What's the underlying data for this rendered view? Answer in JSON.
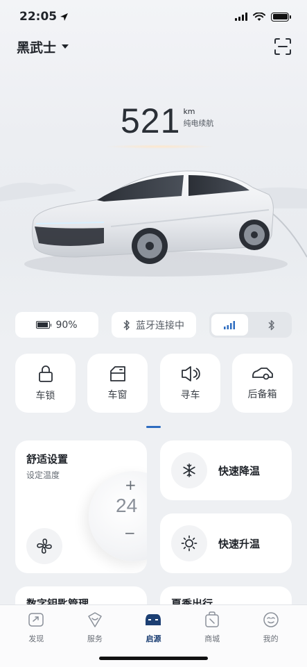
{
  "status": {
    "time": "22:05"
  },
  "header": {
    "vehicle_name": "黑武士"
  },
  "range": {
    "value": "521",
    "unit": "km",
    "label": "纯电续航"
  },
  "status_pills": {
    "battery_percent": "90%",
    "bluetooth_status": "蓝牙连接中"
  },
  "controls": [
    {
      "label": "车锁",
      "icon": "lock-icon"
    },
    {
      "label": "车窗",
      "icon": "window-icon"
    },
    {
      "label": "寻车",
      "icon": "horn-icon"
    },
    {
      "label": "后备箱",
      "icon": "trunk-icon"
    }
  ],
  "comfort": {
    "title": "舒适设置",
    "subtitle": "设定温度",
    "temperature": "24",
    "plus": "+",
    "minus": "−"
  },
  "quick_actions": {
    "cool_label": "快速降温",
    "heat_label": "快速升温"
  },
  "peek_cards": {
    "digital_key": "数字钥匙管理",
    "summer_trip": "夏季出行"
  },
  "tabbar": {
    "items": [
      {
        "label": "发现",
        "active": false
      },
      {
        "label": "服务",
        "active": false
      },
      {
        "label": "启源",
        "active": true
      },
      {
        "label": "商城",
        "active": false
      },
      {
        "label": "我的",
        "active": false
      }
    ]
  },
  "colors": {
    "accent": "#2d6cc0",
    "active_tab": "#1c3f73",
    "background": "#eef0f3",
    "card": "#ffffff"
  }
}
